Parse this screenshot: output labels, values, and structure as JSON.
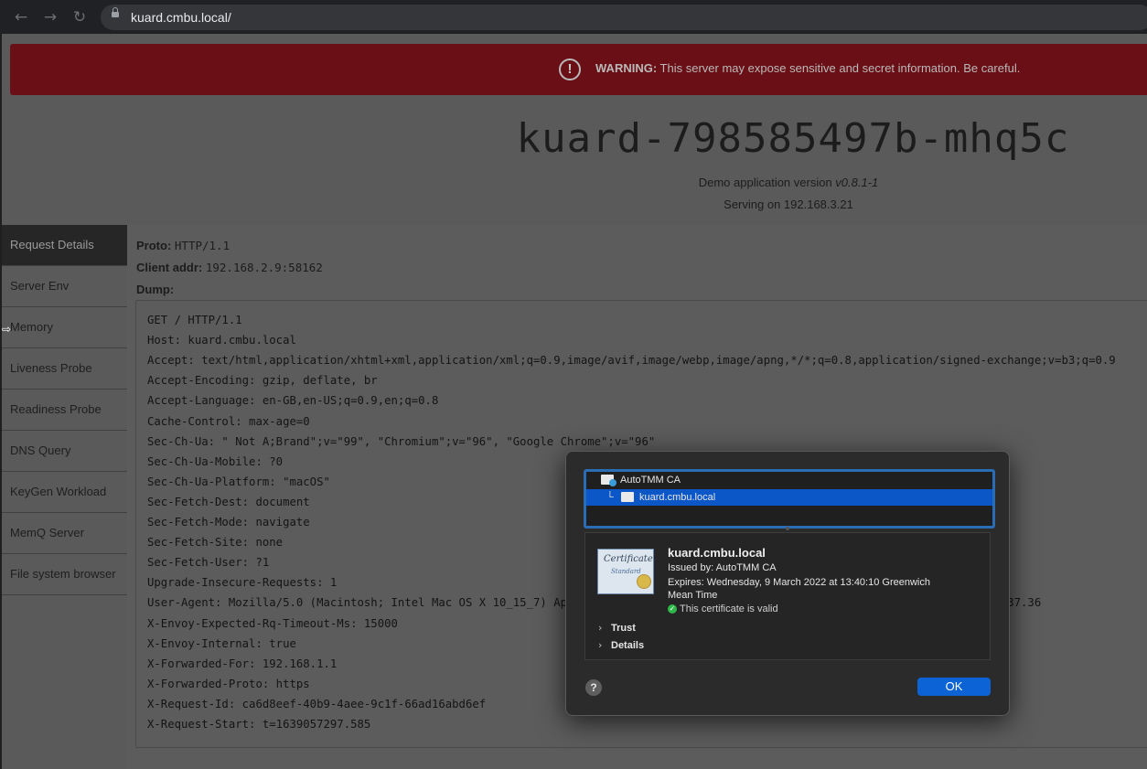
{
  "browser": {
    "back_icon": "arrow-left-icon",
    "forward_icon": "arrow-right-icon",
    "reload_icon": "reload-icon",
    "lock_icon": "lock-icon",
    "url": "kuard.cmbu.local/"
  },
  "warning": {
    "label": "WARNING:",
    "message": " This server may expose sensitive and secret information. Be careful.",
    "color": "#6b0f16"
  },
  "header": {
    "hostname": "kuard-798585497b-mhq5c",
    "version_prefix": "Demo application version ",
    "version": "v0.8.1-1",
    "serving": "Serving on 192.168.3.21"
  },
  "sidebar": {
    "items": [
      {
        "label": "Request Details",
        "active": true
      },
      {
        "label": "Server Env"
      },
      {
        "label": "Memory"
      },
      {
        "label": "Liveness Probe"
      },
      {
        "label": "Readiness Probe"
      },
      {
        "label": "DNS Query"
      },
      {
        "label": "KeyGen Workload"
      },
      {
        "label": "MemQ Server"
      },
      {
        "label": "File system browser"
      }
    ]
  },
  "request": {
    "proto_label": "Proto:",
    "proto_value": "HTTP/1.1",
    "client_label": "Client addr:",
    "client_value": "192.168.2.9:58162",
    "dump_label": "Dump:",
    "dump_lines": [
      "GET / HTTP/1.1",
      "Host: kuard.cmbu.local",
      "Accept: text/html,application/xhtml+xml,application/xml;q=0.9,image/avif,image/webp,image/apng,*/*;q=0.8,application/signed-exchange;v=b3;q=0.9",
      "Accept-Encoding: gzip, deflate, br",
      "Accept-Language: en-GB,en-US;q=0.9,en;q=0.8",
      "Cache-Control: max-age=0",
      "Sec-Ch-Ua: \" Not A;Brand\";v=\"99\", \"Chromium\";v=\"96\", \"Google Chrome\";v=\"96\"",
      "Sec-Ch-Ua-Mobile: ?0",
      "Sec-Ch-Ua-Platform: \"macOS\"",
      "Sec-Fetch-Dest: document",
      "Sec-Fetch-Mode: navigate",
      "Sec-Fetch-Site: none",
      "Sec-Fetch-User: ?1",
      "Upgrade-Insecure-Requests: 1",
      "User-Agent: Mozilla/5.0 (Macintosh; Intel Mac OS X 10_15_7) AppleWebKit/537.36 (KHTML, like Gecko) Chrome/96.0.4664.93 Safari/537.36",
      "X-Envoy-Expected-Rq-Timeout-Ms: 15000",
      "X-Envoy-Internal: true",
      "X-Forwarded-For: 192.168.1.1",
      "X-Forwarded-Proto: https",
      "X-Request-Id: ca6d8eef-40b9-4aee-9c1f-66ad16abd6ef",
      "X-Request-Start: t=1639057297.585"
    ]
  },
  "cert_dialog": {
    "chain": [
      {
        "label": "AutoTMM CA",
        "icon": "certificate-authority-icon"
      },
      {
        "label": "kuard.cmbu.local",
        "icon": "certificate-icon",
        "selected": true
      }
    ],
    "cert_image_title": "Certificate",
    "cert_image_subtitle": "Standard",
    "title": "kuard.cmbu.local",
    "issued_by": "Issued by: AutoTMM CA",
    "expires_line1": "Expires: Wednesday, 9 March 2022 at 13:40:10 Greenwich",
    "expires_line2": "Mean Time",
    "valid_text": "This certificate is valid",
    "trust_label": "Trust",
    "details_label": "Details",
    "help_label": "?",
    "ok_label": "OK",
    "accent_color": "#0b63d6"
  }
}
